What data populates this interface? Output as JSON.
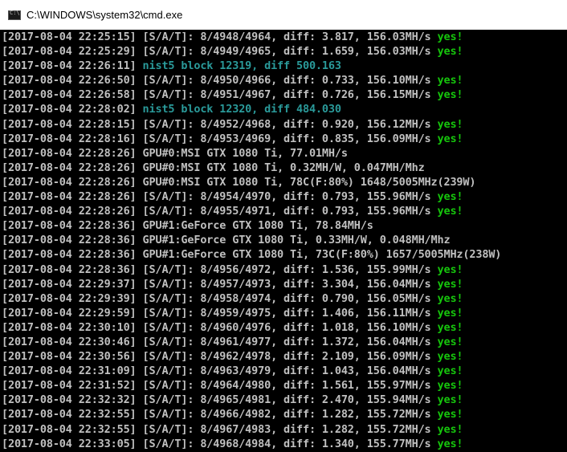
{
  "window": {
    "title": "C:\\WINDOWS\\system32\\cmd.exe"
  },
  "colors": {
    "background": "#000000",
    "text": "#c0c0c0",
    "accepted": "#16c60c",
    "block": "#2a9a9a"
  },
  "console_lines": [
    {
      "ts": "[2017-08-04 22:25:15]",
      "msg": " [S/A/T]: 8/4948/4964, diff: 3.817, 156.03MH/s ",
      "status": "yes!",
      "kind": "share"
    },
    {
      "ts": "[2017-08-04 22:25:29]",
      "msg": " [S/A/T]: 8/4949/4965, diff: 1.659, 156.03MH/s ",
      "status": "yes!",
      "kind": "share"
    },
    {
      "ts": "[2017-08-04 22:26:11]",
      "msg": " nist5 block 12319, diff 500.163",
      "status": "",
      "kind": "block"
    },
    {
      "ts": "[2017-08-04 22:26:50]",
      "msg": " [S/A/T]: 8/4950/4966, diff: 0.733, 156.10MH/s ",
      "status": "yes!",
      "kind": "share"
    },
    {
      "ts": "[2017-08-04 22:26:58]",
      "msg": " [S/A/T]: 8/4951/4967, diff: 0.726, 156.15MH/s ",
      "status": "yes!",
      "kind": "share"
    },
    {
      "ts": "[2017-08-04 22:28:02]",
      "msg": " nist5 block 12320, diff 484.030",
      "status": "",
      "kind": "block"
    },
    {
      "ts": "[2017-08-04 22:28:15]",
      "msg": " [S/A/T]: 8/4952/4968, diff: 0.920, 156.12MH/s ",
      "status": "yes!",
      "kind": "share"
    },
    {
      "ts": "[2017-08-04 22:28:16]",
      "msg": " [S/A/T]: 8/4953/4969, diff: 0.835, 156.09MH/s ",
      "status": "yes!",
      "kind": "share"
    },
    {
      "ts": "[2017-08-04 22:28:26]",
      "msg": " GPU#0:MSI GTX 1080 Ti, 77.01MH/s",
      "status": "",
      "kind": "info"
    },
    {
      "ts": "[2017-08-04 22:28:26]",
      "msg": " GPU#0:MSI GTX 1080 Ti, 0.32MH/W, 0.047MH/Mhz",
      "status": "",
      "kind": "info"
    },
    {
      "ts": "[2017-08-04 22:28:26]",
      "msg": " GPU#0:MSI GTX 1080 Ti, 78C(F:80%) 1648/5005MHz(239W)",
      "status": "",
      "kind": "info"
    },
    {
      "ts": "[2017-08-04 22:28:26]",
      "msg": " [S/A/T]: 8/4954/4970, diff: 0.793, 155.96MH/s ",
      "status": "yes!",
      "kind": "share"
    },
    {
      "ts": "[2017-08-04 22:28:26]",
      "msg": " [S/A/T]: 8/4955/4971, diff: 0.793, 155.96MH/s ",
      "status": "yes!",
      "kind": "share"
    },
    {
      "ts": "[2017-08-04 22:28:36]",
      "msg": " GPU#1:GeForce GTX 1080 Ti, 78.84MH/s",
      "status": "",
      "kind": "info"
    },
    {
      "ts": "[2017-08-04 22:28:36]",
      "msg": " GPU#1:GeForce GTX 1080 Ti, 0.33MH/W, 0.048MH/Mhz",
      "status": "",
      "kind": "info"
    },
    {
      "ts": "[2017-08-04 22:28:36]",
      "msg": " GPU#1:GeForce GTX 1080 Ti, 73C(F:80%) 1657/5005MHz(238W)",
      "status": "",
      "kind": "info"
    },
    {
      "ts": "[2017-08-04 22:28:36]",
      "msg": " [S/A/T]: 8/4956/4972, diff: 1.536, 155.99MH/s ",
      "status": "yes!",
      "kind": "share"
    },
    {
      "ts": "[2017-08-04 22:29:37]",
      "msg": " [S/A/T]: 8/4957/4973, diff: 3.304, 156.04MH/s ",
      "status": "yes!",
      "kind": "share"
    },
    {
      "ts": "[2017-08-04 22:29:39]",
      "msg": " [S/A/T]: 8/4958/4974, diff: 0.790, 156.05MH/s ",
      "status": "yes!",
      "kind": "share"
    },
    {
      "ts": "[2017-08-04 22:29:59]",
      "msg": " [S/A/T]: 8/4959/4975, diff: 1.406, 156.11MH/s ",
      "status": "yes!",
      "kind": "share"
    },
    {
      "ts": "[2017-08-04 22:30:10]",
      "msg": " [S/A/T]: 8/4960/4976, diff: 1.018, 156.10MH/s ",
      "status": "yes!",
      "kind": "share"
    },
    {
      "ts": "[2017-08-04 22:30:46]",
      "msg": " [S/A/T]: 8/4961/4977, diff: 1.372, 156.04MH/s ",
      "status": "yes!",
      "kind": "share"
    },
    {
      "ts": "[2017-08-04 22:30:56]",
      "msg": " [S/A/T]: 8/4962/4978, diff: 2.109, 156.09MH/s ",
      "status": "yes!",
      "kind": "share"
    },
    {
      "ts": "[2017-08-04 22:31:09]",
      "msg": " [S/A/T]: 8/4963/4979, diff: 1.043, 156.04MH/s ",
      "status": "yes!",
      "kind": "share"
    },
    {
      "ts": "[2017-08-04 22:31:52]",
      "msg": " [S/A/T]: 8/4964/4980, diff: 1.561, 155.97MH/s ",
      "status": "yes!",
      "kind": "share"
    },
    {
      "ts": "[2017-08-04 22:32:32]",
      "msg": " [S/A/T]: 8/4965/4981, diff: 2.470, 155.94MH/s ",
      "status": "yes!",
      "kind": "share"
    },
    {
      "ts": "[2017-08-04 22:32:55]",
      "msg": " [S/A/T]: 8/4966/4982, diff: 1.282, 155.72MH/s ",
      "status": "yes!",
      "kind": "share"
    },
    {
      "ts": "[2017-08-04 22:32:55]",
      "msg": " [S/A/T]: 8/4967/4983, diff: 1.282, 155.72MH/s ",
      "status": "yes!",
      "kind": "share"
    },
    {
      "ts": "[2017-08-04 22:33:05]",
      "msg": " [S/A/T]: 8/4968/4984, diff: 1.340, 155.77MH/s ",
      "status": "yes!",
      "kind": "share"
    }
  ]
}
